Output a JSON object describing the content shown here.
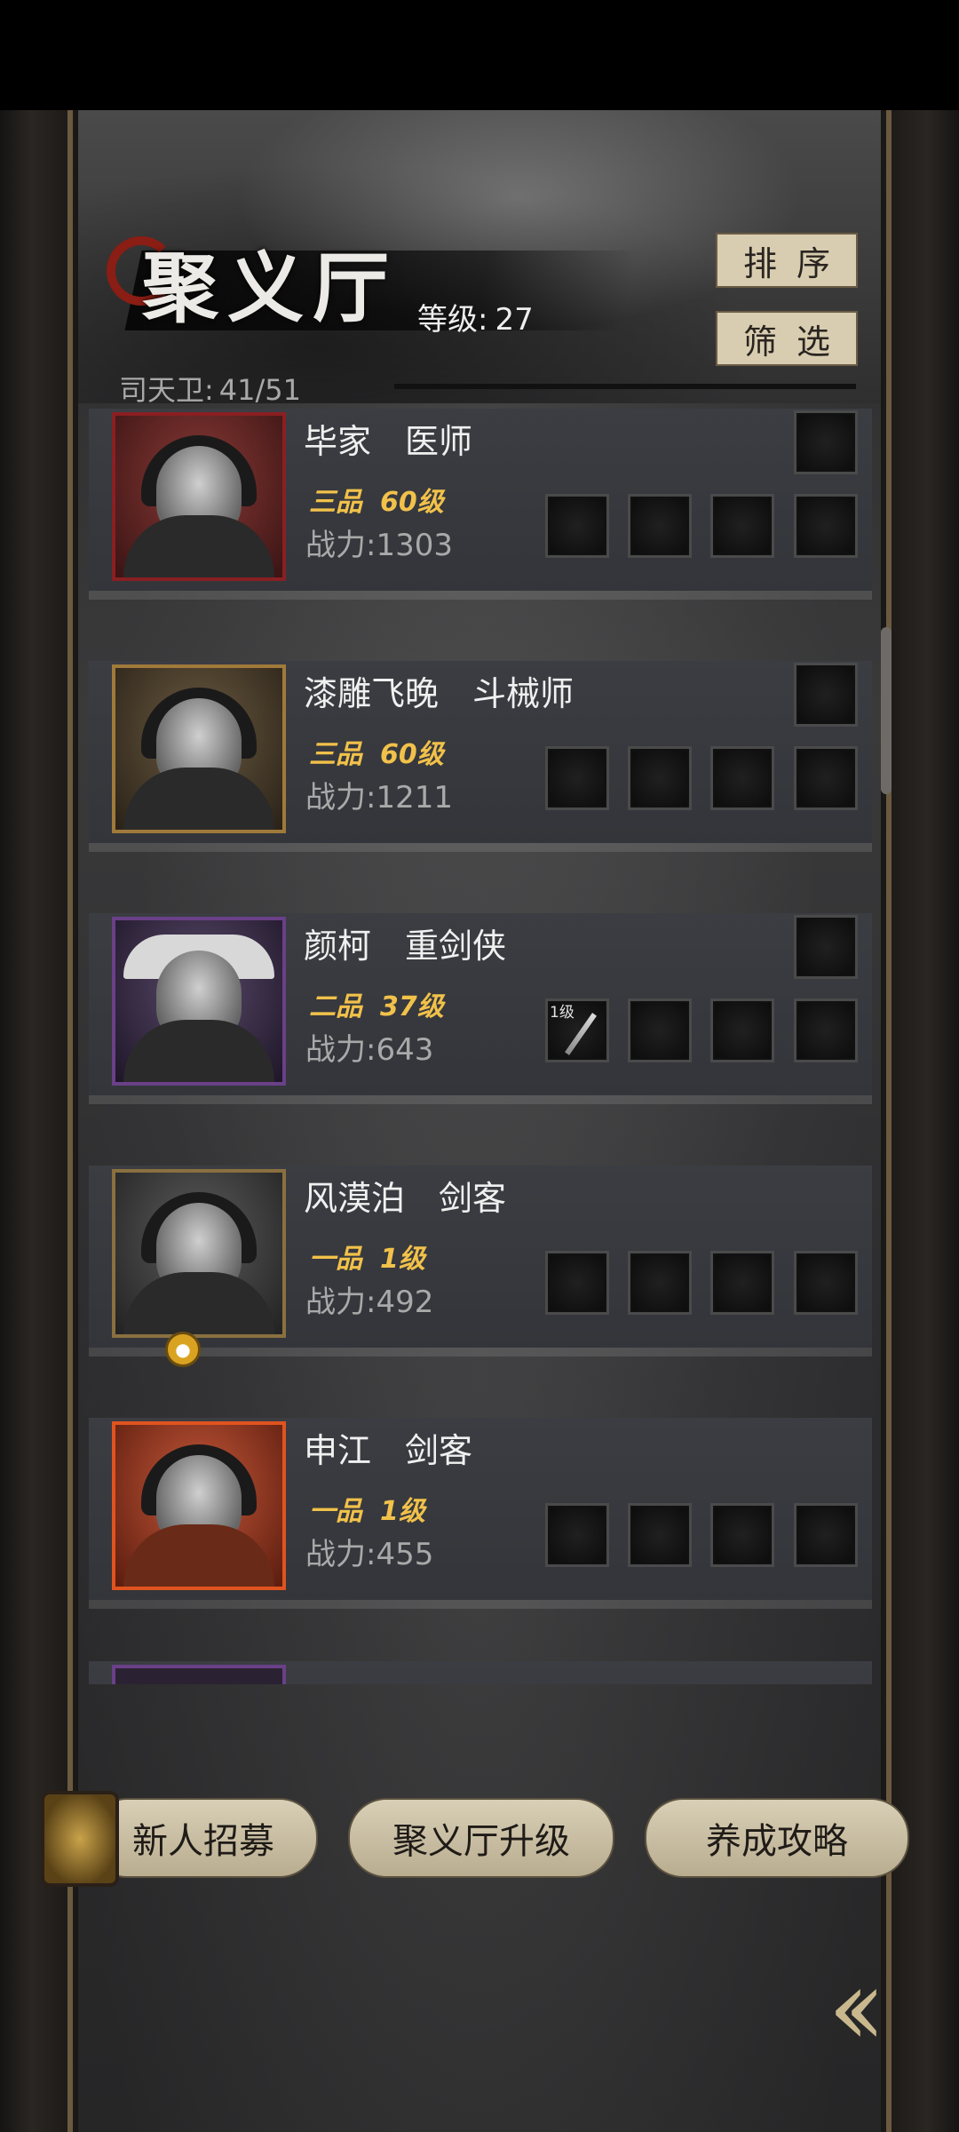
{
  "header": {
    "title": "聚义厅",
    "level_label": "等级:",
    "level_value": "27",
    "guard_label": "司天卫:",
    "guard_value": "41/51",
    "sort_label": "排序",
    "filter_label": "筛选"
  },
  "heroes": [
    {
      "name": "毕家",
      "role": "医师",
      "grade": "三品",
      "level": "60级",
      "power": "战力:1303",
      "frame_color": "#8a1f22"
    },
    {
      "name": "漆雕飞晚",
      "role": "斗械师",
      "grade": "三品",
      "level": "60级",
      "power": "战力:1211",
      "frame_color": "#a07a3a"
    },
    {
      "name": "颜柯",
      "role": "重剑侠",
      "grade": "二品",
      "level": "37级",
      "power": "战力:643",
      "frame_color": "#6a4088",
      "slot_level": "1级"
    },
    {
      "name": "风漠泊",
      "role": "剑客",
      "grade": "一品",
      "level": "1级",
      "power": "战力:492",
      "frame_color": "#8a7040"
    },
    {
      "name": "申江",
      "role": "剑客",
      "grade": "一品",
      "level": "1级",
      "power": "战力:455",
      "frame_color": "#e0531f"
    }
  ],
  "bottom": {
    "recruit_label": "新人招募",
    "upgrade_label": "聚义厅升级",
    "guide_label": "养成攻略",
    "back_icon": "double-chevron-left-icon"
  }
}
